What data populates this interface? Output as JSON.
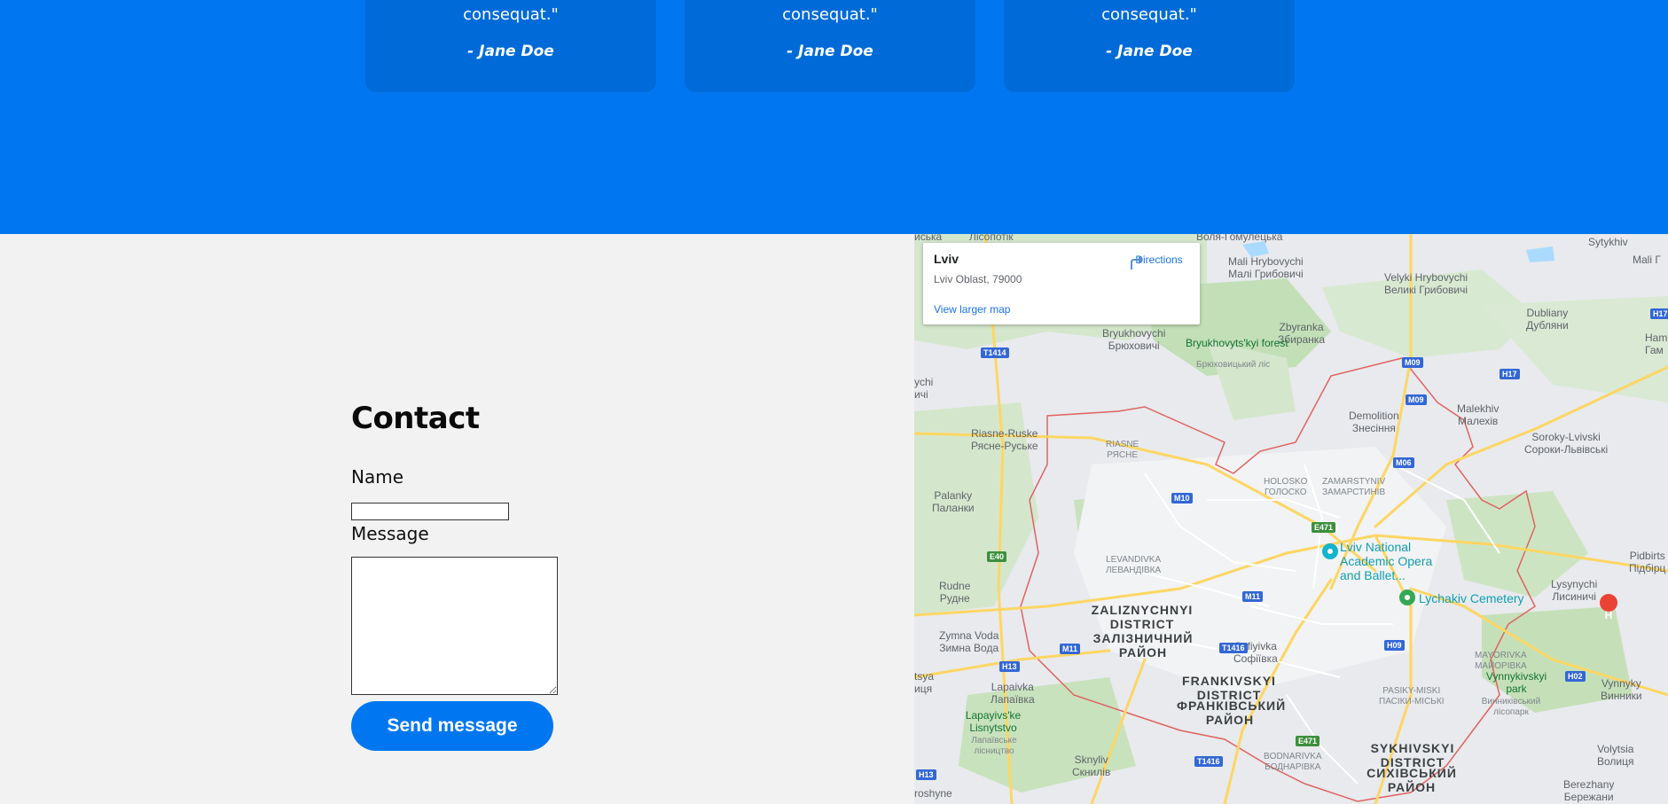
{
  "testimonials": [
    {
      "quote_tail": "consequat.\"",
      "author": "- Jane Doe"
    },
    {
      "quote_tail": "consequat.\"",
      "author": "- Jane Doe"
    },
    {
      "quote_tail": "consequat.\"",
      "author": "- Jane Doe"
    }
  ],
  "contact": {
    "title": "Contact",
    "name_label": "Name",
    "name_value": "",
    "message_label": "Message",
    "message_value": "",
    "send_label": "Send message"
  },
  "map": {
    "place_name": "Lviv",
    "place_address": "Lviv Oblast, 79000",
    "directions_label": "Directions",
    "larger_map_label": "View larger map",
    "labels": {
      "bryukhovychi": "Bryukhovychi",
      "bryukhovychi_uk": "Брюховичі",
      "mali_hrybovychi": "Mali Hrybovychi",
      "mali_hrybovychi_uk": "Малі Грибовичі",
      "velyki_hrybovychi": "Velyki Hrybovychi",
      "velyki_hrybovychi_uk": "Великі Грибовичі",
      "zbyranka": "Zbyranka",
      "zbyranka_uk": "Збиранка",
      "dubliany": "Dubliany",
      "dubliany_uk": "Дубляни",
      "forest": "Bryukhovyts'kyi forest",
      "forest_uk": "Брюховицький ліс",
      "demolition": "Demolition",
      "demolition_uk": "Знесіння",
      "malekhiv": "Malekhiv",
      "malekhiv_uk": "Малехів",
      "soroky": "Soroky-Lvivski",
      "soroky_uk": "Сороки-Львівські",
      "riasne_ruske": "Riasne-Ruske",
      "riasne_ruske_uk": "Рясне-Руське",
      "riasne": "RIASNE",
      "riasne_uk": "РЯСНЕ",
      "holosko": "HOLOSKO",
      "holosko_uk": "ГОЛОСКО",
      "zamarstyniv": "ZAMARSTYNIV",
      "zamarstyniv_uk": "ЗАМАРСТИНІВ",
      "palanky": "Palanky",
      "palanky_uk": "Паланки",
      "opera": "Lviv National Academic Opera and Ballet...",
      "levandivka": "LEVANDIVKA",
      "levandivka_uk": "ЛЕВАНДІВКА",
      "rudne": "Rudne",
      "rudne_uk": "Рудне",
      "lychakiv": "Lychakiv Cemetery",
      "lysynychi": "Lysynychi",
      "lysynychi_uk": "Лисиничі",
      "pidbirtsi": "Pidbirts",
      "pidbirtsi_uk": "Підбірц",
      "zaliznychnyi": "ZALIZNYCHNYI DISTRICT",
      "zaliznychnyi_uk": "ЗАЛІЗНИЧНИЙ РАЙОН",
      "zymna_voda": "Zymna Voda",
      "zymna_voda_uk": "Зимна Вода",
      "sofiyivka": "Sofiyivka",
      "sofiyivka_uk": "Софіївка",
      "mayorivka": "MAYORIVKA",
      "mayorivka_uk": "МАЙОРІВКА",
      "vynnykivskyi": "Vynnykivskyi park",
      "vynnykivskyi_uk": "Винниківський лісопарк",
      "frankivskyi": "FRANKIVSKYI DISTRICT",
      "frankivskyi_uk": "ФРАНКІВСЬКИЙ РАЙОН",
      "pasiky": "PASIKY-MISKI",
      "pasiky_uk": "ПАСІКИ-МІСЬКІ",
      "lapaivka": "Lapaivka",
      "lapaivka_uk": "Лапаївка",
      "lapayivske": "Lapayivs'ke Lisnytstvo",
      "lapayivske_uk": "Лапаївське лісництво",
      "skomyliv": "Sknyliv",
      "skomyliv_uk": "Скнилів",
      "bodnarivka": "BODNARIVKA",
      "bodnarivka_uk": "БОДНАРІВКА",
      "sykhivskyi": "SYKHIVSKYI DISTRICT",
      "sykhivskyi_uk": "СИХІВСЬКИЙ РАЙОН",
      "vynnyky": "Vynnyky",
      "vynnyky_uk": "Винники",
      "volytsia": "Volytsia",
      "volytsia_uk": "Волиця",
      "berezhany": "Berezhany",
      "berezhany_uk": "Бережани",
      "sytykhiv": "Sytykhiv",
      "voliagomul": "Воля-Гомулецька",
      "lisopotik": "Лісопотік",
      "yuchi": "ychi",
      "yuchi_uk": "ичі",
      "tsya": "tsya",
      "tsya_uk": "иця",
      "roshyne": "roshyne",
      "mali_g": "Mali Г",
      "ham": "Ham",
      "ham_uk": "Гам",
      "iska": "иська"
    },
    "shields": [
      "T1414",
      "M09",
      "M09",
      "H17",
      "H17",
      "M06",
      "M10",
      "E471",
      "E40",
      "M11",
      "M11",
      "H13",
      "T1416",
      "H09",
      "H02",
      "E471",
      "T1416",
      "H13"
    ]
  },
  "colors": {
    "brand_blue": "#0077f0",
    "card_blue": "#006bd8",
    "map_link": "#1a73e8"
  }
}
